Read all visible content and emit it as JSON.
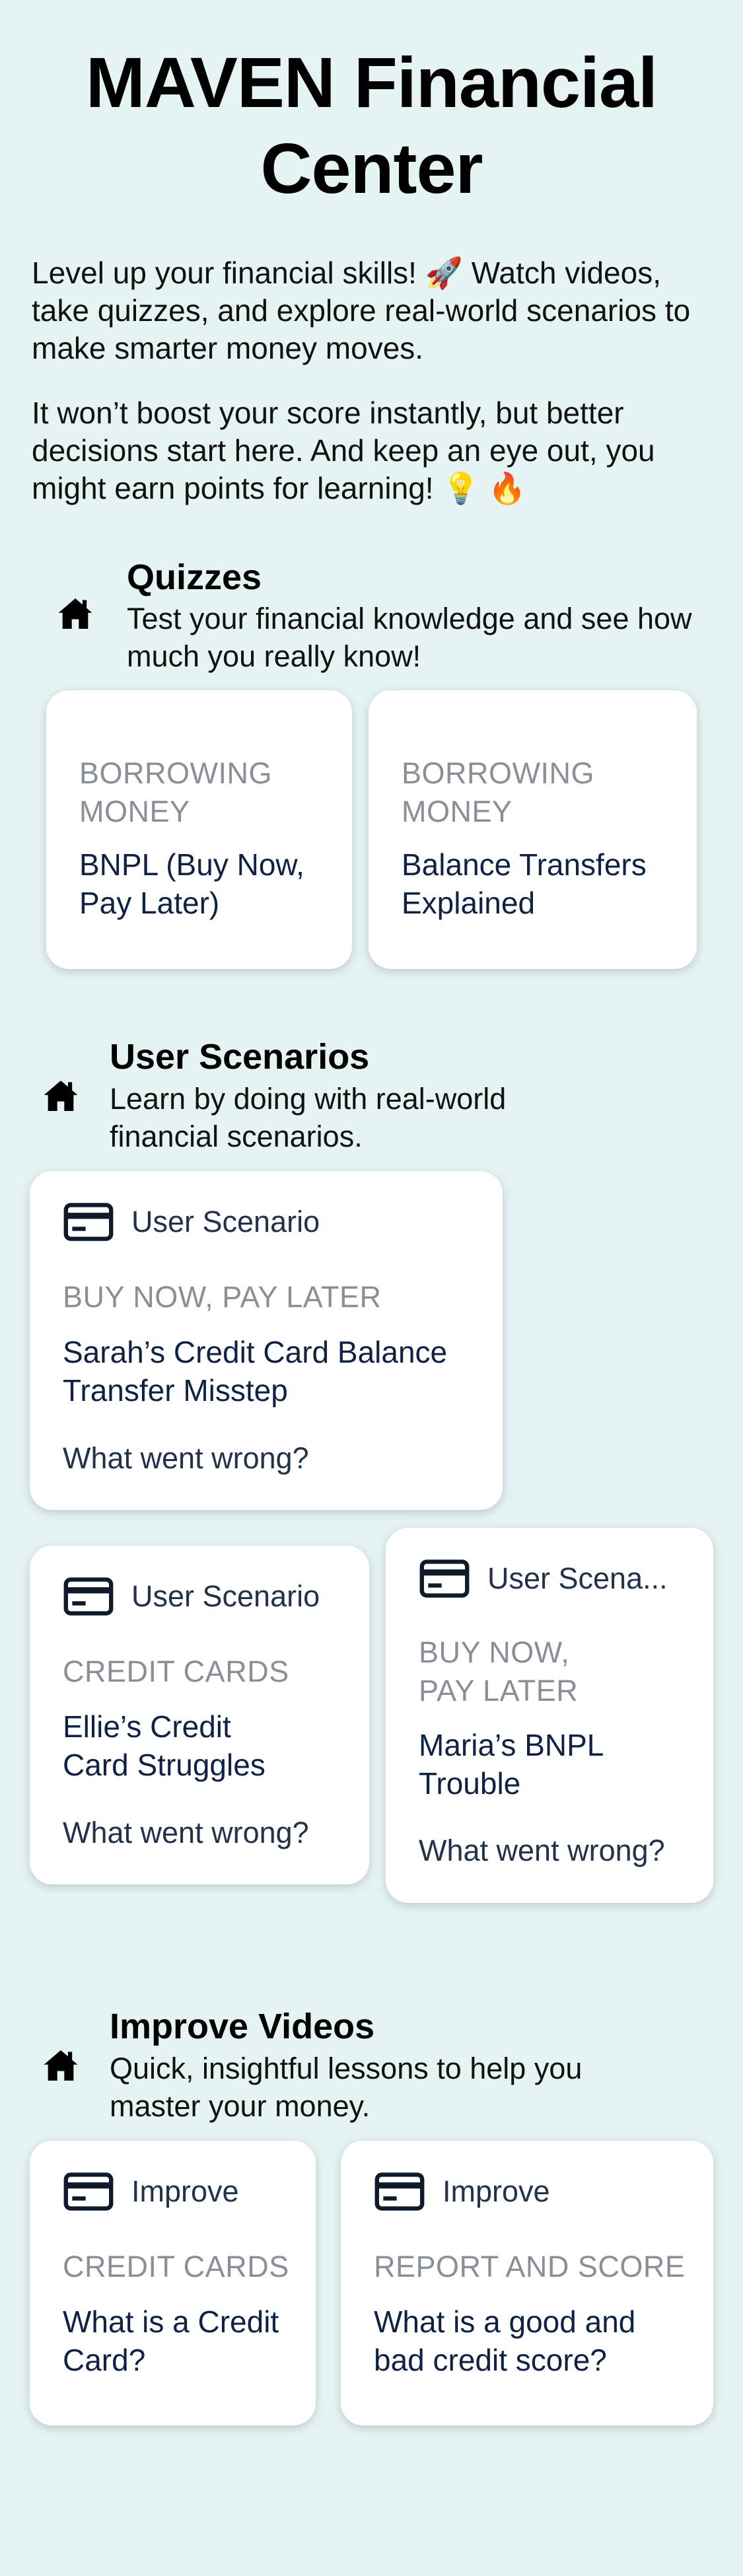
{
  "page_title": "MAVEN Financial Center",
  "intro": {
    "p1": "Level up your financial skills! 🚀 Watch videos, take quizzes, and explore real-world scenarios to make smarter money moves.",
    "p2": "It won’t boost your score instantly, but better decisions start here. And keep an eye out, you might earn points for learning! 💡 🔥"
  },
  "quizzes": {
    "icon": "home-icon",
    "title": "Quizzes",
    "subtitle": "Test your financial knowledge and see how much you really know!",
    "cards": [
      {
        "category": "BORROWING MONEY",
        "title": "BNPL (Buy Now, Pay Later)"
      },
      {
        "category": "BORROWING MONEY",
        "title": "Balance Transfers Explained"
      }
    ]
  },
  "scenarios": {
    "icon": "home-icon",
    "title": "User Scenarios",
    "subtitle": "Learn by doing with real-world financial scenarios.",
    "cards": [
      {
        "icon": "credit-card-icon",
        "label": "User Scenario",
        "category": "BUY NOW, PAY LATER",
        "title": "Sarah’s Credit Card Balance Transfer Misstep",
        "cta": "What went wrong?"
      },
      {
        "icon": "credit-card-icon",
        "label": "User Scenario",
        "category": "CREDIT CARDS",
        "title": "Ellie’s Credit Card Struggles",
        "cta": "What went wrong?"
      },
      {
        "icon": "credit-card-icon",
        "label": "User Scena...",
        "category": "BUY NOW, PAY LATER",
        "title": "Maria’s BNPL Trouble",
        "cta": "What went wrong?"
      }
    ]
  },
  "videos": {
    "icon": "home-icon",
    "title": "Improve Videos",
    "subtitle": "Quick, insightful lessons to help you master your money.",
    "cards": [
      {
        "icon": "credit-card-icon",
        "label": "Improve",
        "category": "CREDIT CARDS",
        "title": "What is a Credit Card?"
      },
      {
        "icon": "credit-card-icon",
        "label": "Improve",
        "category": "REPORT AND SCORE",
        "title": "What is a good and bad credit score?"
      }
    ]
  }
}
